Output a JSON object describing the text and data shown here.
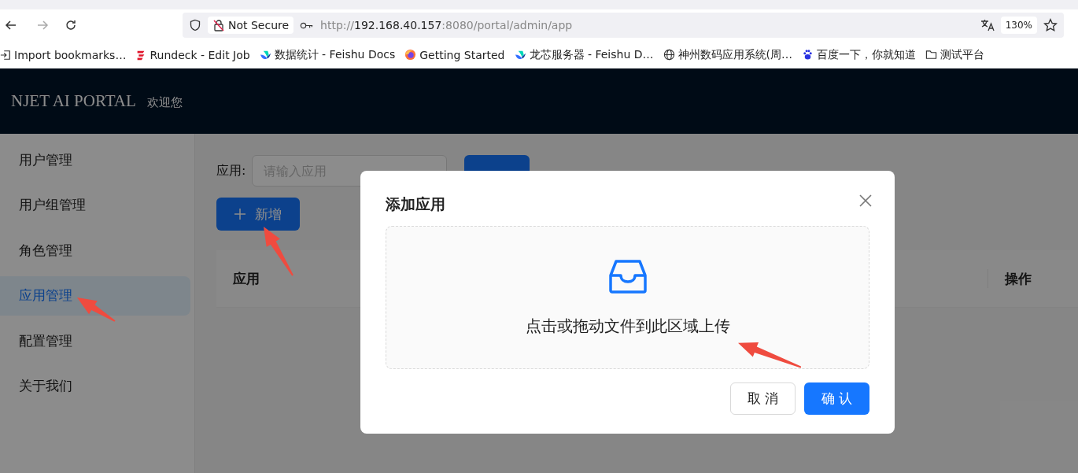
{
  "browser": {
    "security_label": "Not Secure",
    "url": {
      "prefix": "http://",
      "host": "192.168.40.157",
      "path": ":8080/portal/admin/app"
    },
    "zoom": "130%",
    "bookmarks": [
      {
        "kind": "import",
        "label": "Import bookmarks…"
      },
      {
        "kind": "rundeck",
        "label": "Rundeck - Edit Job"
      },
      {
        "kind": "feishu",
        "label": "数据统计 - Feishu Docs"
      },
      {
        "kind": "firefox",
        "label": "Getting Started"
      },
      {
        "kind": "feishu",
        "label": "龙芯服务器 - Feishu D…"
      },
      {
        "kind": "globe",
        "label": "神州数码应用系统(周…"
      },
      {
        "kind": "paw",
        "label": "百度一下，你就知道"
      },
      {
        "kind": "folder",
        "label": "测试平台"
      }
    ]
  },
  "header": {
    "title": "NJET AI PORTAL",
    "greeting": "欢迎您"
  },
  "sidebar": {
    "items": [
      {
        "label": "用户管理",
        "selected": false
      },
      {
        "label": "用户组管理",
        "selected": false
      },
      {
        "label": "角色管理",
        "selected": false
      },
      {
        "label": "应用管理",
        "selected": true
      },
      {
        "label": "配置管理",
        "selected": false
      },
      {
        "label": "关于我们",
        "selected": false
      }
    ]
  },
  "search": {
    "label": "应用:",
    "placeholder": "请输入应用"
  },
  "add_button": "新增",
  "table": {
    "columns": [
      "应用",
      "操作"
    ]
  },
  "modal": {
    "title": "添加应用",
    "upload_hint": "点击或拖动文件到此区域上传",
    "buttons": [
      {
        "kind": "cancel",
        "label": "取 消"
      },
      {
        "kind": "primary",
        "label": "确 认"
      }
    ]
  }
}
